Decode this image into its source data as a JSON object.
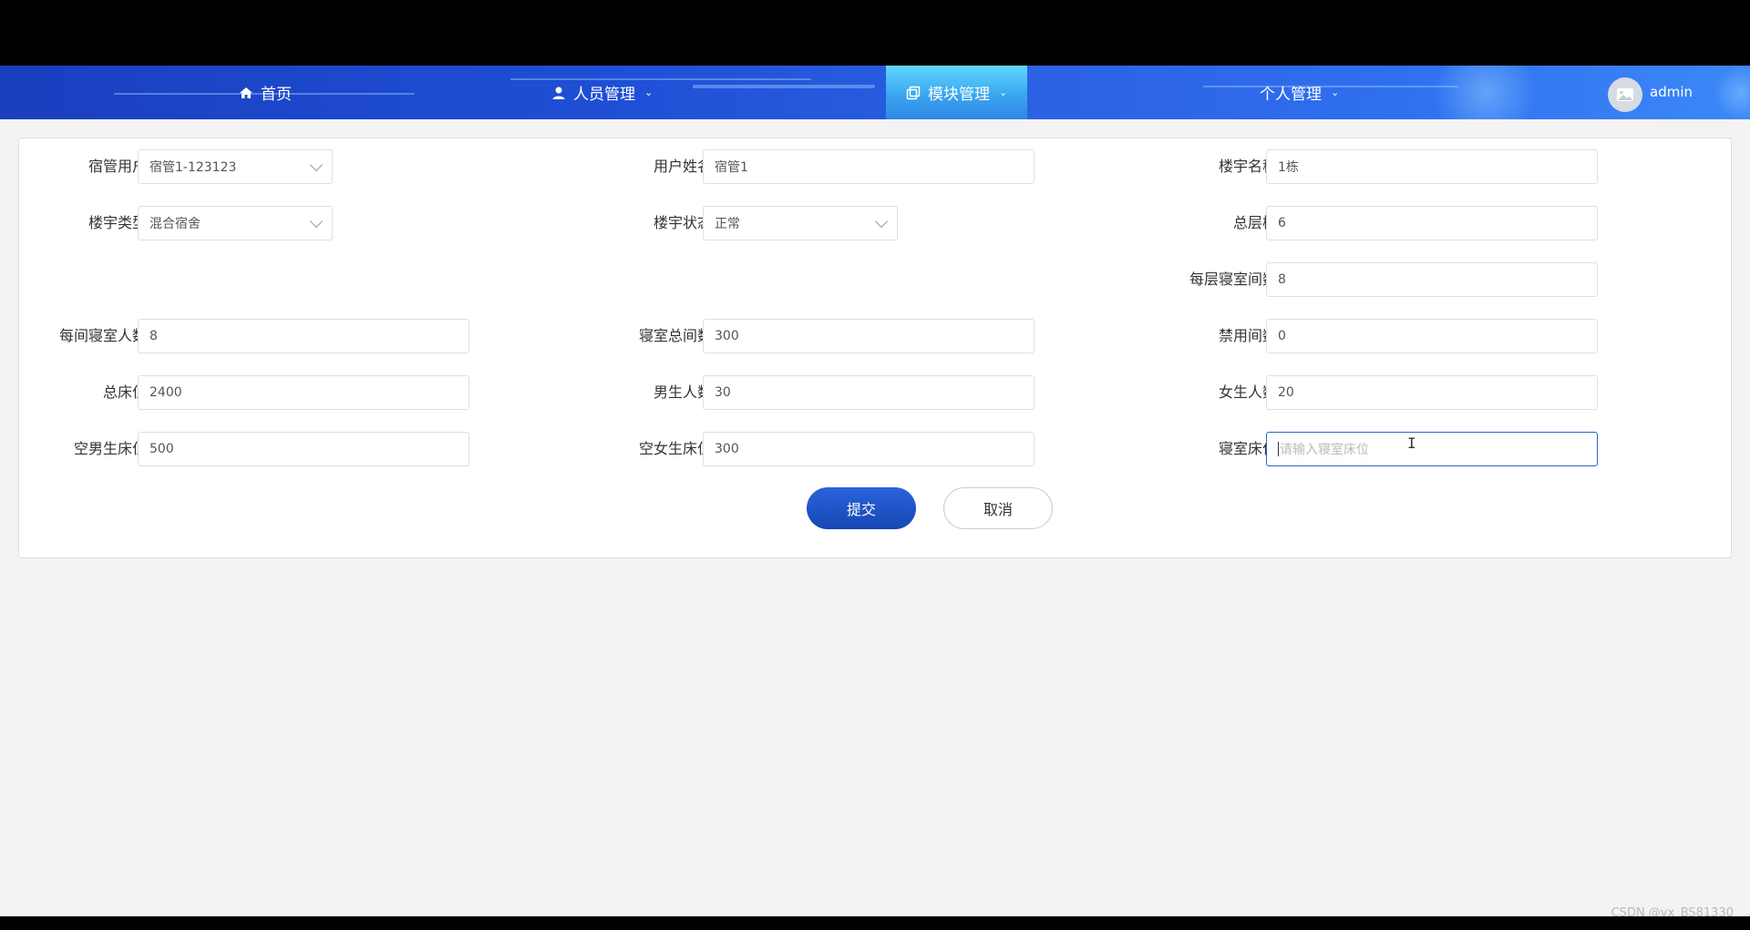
{
  "nav": {
    "home": "首页",
    "staff": "人员管理",
    "modules": "模块管理",
    "personal": "个人管理",
    "user": "admin"
  },
  "form": {
    "dorm_manager_user": {
      "label": "宿管用户",
      "value": "宿管1-123123"
    },
    "user_name": {
      "label": "用户姓名",
      "value": "宿管1"
    },
    "building_name": {
      "label": "楼宇名称",
      "value": "1栋"
    },
    "building_type": {
      "label": "楼宇类型",
      "value": "混合宿舍"
    },
    "building_status": {
      "label": "楼宇状态",
      "value": "正常"
    },
    "total_floors": {
      "label": "总层楼",
      "value": "6"
    },
    "rooms_per_floor": {
      "label": "每层寝室间数",
      "value": "8"
    },
    "people_per_room": {
      "label": "每间寝室人数",
      "value": "8"
    },
    "total_rooms": {
      "label": "寝室总间数",
      "value": "300"
    },
    "disabled_rooms": {
      "label": "禁用间数",
      "value": "0"
    },
    "total_beds": {
      "label": "总床位",
      "value": "2400"
    },
    "male_count": {
      "label": "男生人数",
      "value": "30"
    },
    "female_count": {
      "label": "女生人数",
      "value": "20"
    },
    "empty_male_beds": {
      "label": "空男生床位",
      "value": "500"
    },
    "empty_female_beds": {
      "label": "空女生床位",
      "value": "300"
    },
    "room_beds": {
      "label": "寝室床位",
      "placeholder": "请输入寝室床位"
    }
  },
  "buttons": {
    "submit": "提交",
    "cancel": "取消"
  },
  "watermark": "CSDN @vx_BS81330"
}
